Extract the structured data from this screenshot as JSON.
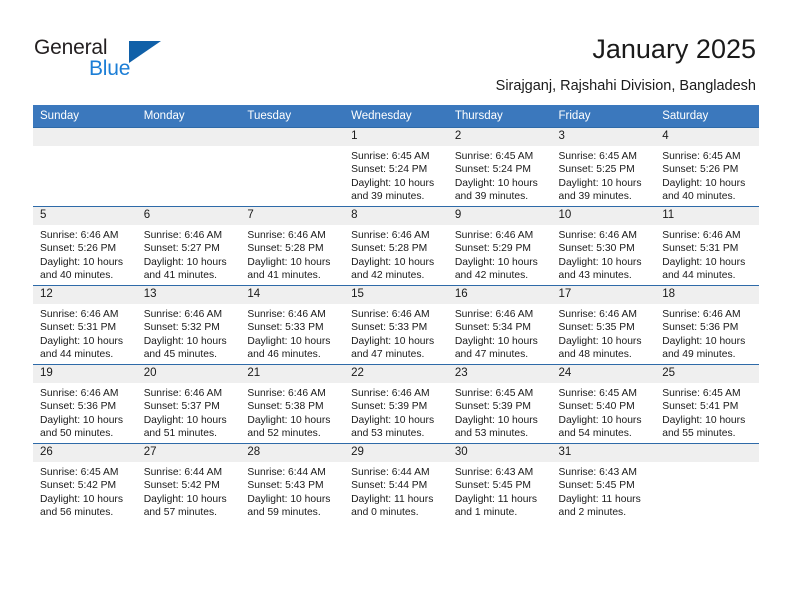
{
  "brand": {
    "name_part1": "General",
    "name_part2": "Blue",
    "triangle_color": "#1060a8",
    "blue_color": "#1c7ed6"
  },
  "header": {
    "title": "January 2025",
    "subtitle": "Sirajganj, Rajshahi Division, Bangladesh"
  },
  "theme": {
    "header_bg": "#3b78bd",
    "row_line": "#2e6aa8",
    "date_band": "#efefef"
  },
  "weekday_headers": [
    "Sunday",
    "Monday",
    "Tuesday",
    "Wednesday",
    "Thursday",
    "Friday",
    "Saturday"
  ],
  "weeks": [
    [
      {
        "day": "",
        "sunrise": "",
        "sunset": "",
        "daylight_line1": "",
        "daylight_line2": "",
        "empty": true
      },
      {
        "day": "",
        "sunrise": "",
        "sunset": "",
        "daylight_line1": "",
        "daylight_line2": "",
        "empty": true
      },
      {
        "day": "",
        "sunrise": "",
        "sunset": "",
        "daylight_line1": "",
        "daylight_line2": "",
        "empty": true
      },
      {
        "day": "1",
        "sunrise": "Sunrise: 6:45 AM",
        "sunset": "Sunset: 5:24 PM",
        "daylight_line1": "Daylight: 10 hours",
        "daylight_line2": "and 39 minutes."
      },
      {
        "day": "2",
        "sunrise": "Sunrise: 6:45 AM",
        "sunset": "Sunset: 5:24 PM",
        "daylight_line1": "Daylight: 10 hours",
        "daylight_line2": "and 39 minutes."
      },
      {
        "day": "3",
        "sunrise": "Sunrise: 6:45 AM",
        "sunset": "Sunset: 5:25 PM",
        "daylight_line1": "Daylight: 10 hours",
        "daylight_line2": "and 39 minutes."
      },
      {
        "day": "4",
        "sunrise": "Sunrise: 6:45 AM",
        "sunset": "Sunset: 5:26 PM",
        "daylight_line1": "Daylight: 10 hours",
        "daylight_line2": "and 40 minutes."
      }
    ],
    [
      {
        "day": "5",
        "sunrise": "Sunrise: 6:46 AM",
        "sunset": "Sunset: 5:26 PM",
        "daylight_line1": "Daylight: 10 hours",
        "daylight_line2": "and 40 minutes."
      },
      {
        "day": "6",
        "sunrise": "Sunrise: 6:46 AM",
        "sunset": "Sunset: 5:27 PM",
        "daylight_line1": "Daylight: 10 hours",
        "daylight_line2": "and 41 minutes."
      },
      {
        "day": "7",
        "sunrise": "Sunrise: 6:46 AM",
        "sunset": "Sunset: 5:28 PM",
        "daylight_line1": "Daylight: 10 hours",
        "daylight_line2": "and 41 minutes."
      },
      {
        "day": "8",
        "sunrise": "Sunrise: 6:46 AM",
        "sunset": "Sunset: 5:28 PM",
        "daylight_line1": "Daylight: 10 hours",
        "daylight_line2": "and 42 minutes."
      },
      {
        "day": "9",
        "sunrise": "Sunrise: 6:46 AM",
        "sunset": "Sunset: 5:29 PM",
        "daylight_line1": "Daylight: 10 hours",
        "daylight_line2": "and 42 minutes."
      },
      {
        "day": "10",
        "sunrise": "Sunrise: 6:46 AM",
        "sunset": "Sunset: 5:30 PM",
        "daylight_line1": "Daylight: 10 hours",
        "daylight_line2": "and 43 minutes."
      },
      {
        "day": "11",
        "sunrise": "Sunrise: 6:46 AM",
        "sunset": "Sunset: 5:31 PM",
        "daylight_line1": "Daylight: 10 hours",
        "daylight_line2": "and 44 minutes."
      }
    ],
    [
      {
        "day": "12",
        "sunrise": "Sunrise: 6:46 AM",
        "sunset": "Sunset: 5:31 PM",
        "daylight_line1": "Daylight: 10 hours",
        "daylight_line2": "and 44 minutes."
      },
      {
        "day": "13",
        "sunrise": "Sunrise: 6:46 AM",
        "sunset": "Sunset: 5:32 PM",
        "daylight_line1": "Daylight: 10 hours",
        "daylight_line2": "and 45 minutes."
      },
      {
        "day": "14",
        "sunrise": "Sunrise: 6:46 AM",
        "sunset": "Sunset: 5:33 PM",
        "daylight_line1": "Daylight: 10 hours",
        "daylight_line2": "and 46 minutes."
      },
      {
        "day": "15",
        "sunrise": "Sunrise: 6:46 AM",
        "sunset": "Sunset: 5:33 PM",
        "daylight_line1": "Daylight: 10 hours",
        "daylight_line2": "and 47 minutes."
      },
      {
        "day": "16",
        "sunrise": "Sunrise: 6:46 AM",
        "sunset": "Sunset: 5:34 PM",
        "daylight_line1": "Daylight: 10 hours",
        "daylight_line2": "and 47 minutes."
      },
      {
        "day": "17",
        "sunrise": "Sunrise: 6:46 AM",
        "sunset": "Sunset: 5:35 PM",
        "daylight_line1": "Daylight: 10 hours",
        "daylight_line2": "and 48 minutes."
      },
      {
        "day": "18",
        "sunrise": "Sunrise: 6:46 AM",
        "sunset": "Sunset: 5:36 PM",
        "daylight_line1": "Daylight: 10 hours",
        "daylight_line2": "and 49 minutes."
      }
    ],
    [
      {
        "day": "19",
        "sunrise": "Sunrise: 6:46 AM",
        "sunset": "Sunset: 5:36 PM",
        "daylight_line1": "Daylight: 10 hours",
        "daylight_line2": "and 50 minutes."
      },
      {
        "day": "20",
        "sunrise": "Sunrise: 6:46 AM",
        "sunset": "Sunset: 5:37 PM",
        "daylight_line1": "Daylight: 10 hours",
        "daylight_line2": "and 51 minutes."
      },
      {
        "day": "21",
        "sunrise": "Sunrise: 6:46 AM",
        "sunset": "Sunset: 5:38 PM",
        "daylight_line1": "Daylight: 10 hours",
        "daylight_line2": "and 52 minutes."
      },
      {
        "day": "22",
        "sunrise": "Sunrise: 6:46 AM",
        "sunset": "Sunset: 5:39 PM",
        "daylight_line1": "Daylight: 10 hours",
        "daylight_line2": "and 53 minutes."
      },
      {
        "day": "23",
        "sunrise": "Sunrise: 6:45 AM",
        "sunset": "Sunset: 5:39 PM",
        "daylight_line1": "Daylight: 10 hours",
        "daylight_line2": "and 53 minutes."
      },
      {
        "day": "24",
        "sunrise": "Sunrise: 6:45 AM",
        "sunset": "Sunset: 5:40 PM",
        "daylight_line1": "Daylight: 10 hours",
        "daylight_line2": "and 54 minutes."
      },
      {
        "day": "25",
        "sunrise": "Sunrise: 6:45 AM",
        "sunset": "Sunset: 5:41 PM",
        "daylight_line1": "Daylight: 10 hours",
        "daylight_line2": "and 55 minutes."
      }
    ],
    [
      {
        "day": "26",
        "sunrise": "Sunrise: 6:45 AM",
        "sunset": "Sunset: 5:42 PM",
        "daylight_line1": "Daylight: 10 hours",
        "daylight_line2": "and 56 minutes."
      },
      {
        "day": "27",
        "sunrise": "Sunrise: 6:44 AM",
        "sunset": "Sunset: 5:42 PM",
        "daylight_line1": "Daylight: 10 hours",
        "daylight_line2": "and 57 minutes."
      },
      {
        "day": "28",
        "sunrise": "Sunrise: 6:44 AM",
        "sunset": "Sunset: 5:43 PM",
        "daylight_line1": "Daylight: 10 hours",
        "daylight_line2": "and 59 minutes."
      },
      {
        "day": "29",
        "sunrise": "Sunrise: 6:44 AM",
        "sunset": "Sunset: 5:44 PM",
        "daylight_line1": "Daylight: 11 hours",
        "daylight_line2": "and 0 minutes."
      },
      {
        "day": "30",
        "sunrise": "Sunrise: 6:43 AM",
        "sunset": "Sunset: 5:45 PM",
        "daylight_line1": "Daylight: 11 hours",
        "daylight_line2": "and 1 minute."
      },
      {
        "day": "31",
        "sunrise": "Sunrise: 6:43 AM",
        "sunset": "Sunset: 5:45 PM",
        "daylight_line1": "Daylight: 11 hours",
        "daylight_line2": "and 2 minutes."
      },
      {
        "day": "",
        "sunrise": "",
        "sunset": "",
        "daylight_line1": "",
        "daylight_line2": "",
        "empty": true
      }
    ]
  ]
}
